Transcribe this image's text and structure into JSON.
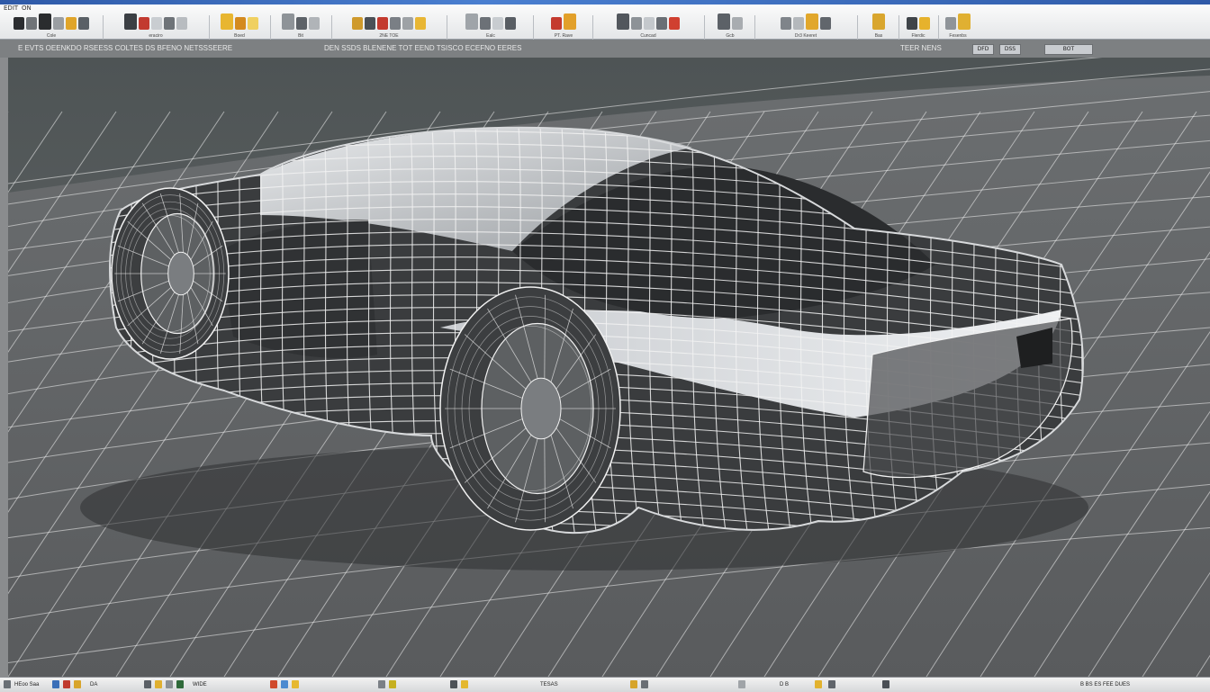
{
  "window": {
    "title": "EDIT  ON"
  },
  "ribbon": {
    "tabs": [
      "EDIT",
      "ON"
    ],
    "groups": [
      {
        "label": "Cole"
      },
      {
        "label": "eraciro"
      },
      {
        "label": "Boed"
      },
      {
        "label": "Bit"
      },
      {
        "label": "2NE TOE"
      },
      {
        "label": "Ealc"
      },
      {
        "label": "PT. Rave"
      },
      {
        "label": "Cuncad"
      },
      {
        "label": "Gcb"
      },
      {
        "label": "Dr3 Keeret"
      },
      {
        "label": "Bas"
      },
      {
        "label": "Flerdic"
      },
      {
        "label": "Fesenbs"
      }
    ]
  },
  "status_row": {
    "left_text": "E EVTS  OEENKDO RSEESS  COLTES  DS  BFENO  NETSSSEERE",
    "center_text": "DEN SSDS BLENENE  TOT   EEND TSISCO  ECEFNO EERES",
    "right_text": "TEER NENS",
    "buttons": [
      "DFD",
      "DSS",
      "BOT"
    ]
  },
  "viewport": {
    "object": "wireframe car model on wireframe ground plane",
    "colors": {
      "background": "#585a5b",
      "mesh": "#f2f2f2",
      "body": "#3a3c3e",
      "highlight": "#d8dadc"
    }
  },
  "bottom_bar": {
    "items": [
      "HEoo  Saa",
      "DA",
      "WIDE",
      "TESAS",
      "D  B"
    ],
    "right_text": "B  BS  ES  FEE  DUES"
  }
}
